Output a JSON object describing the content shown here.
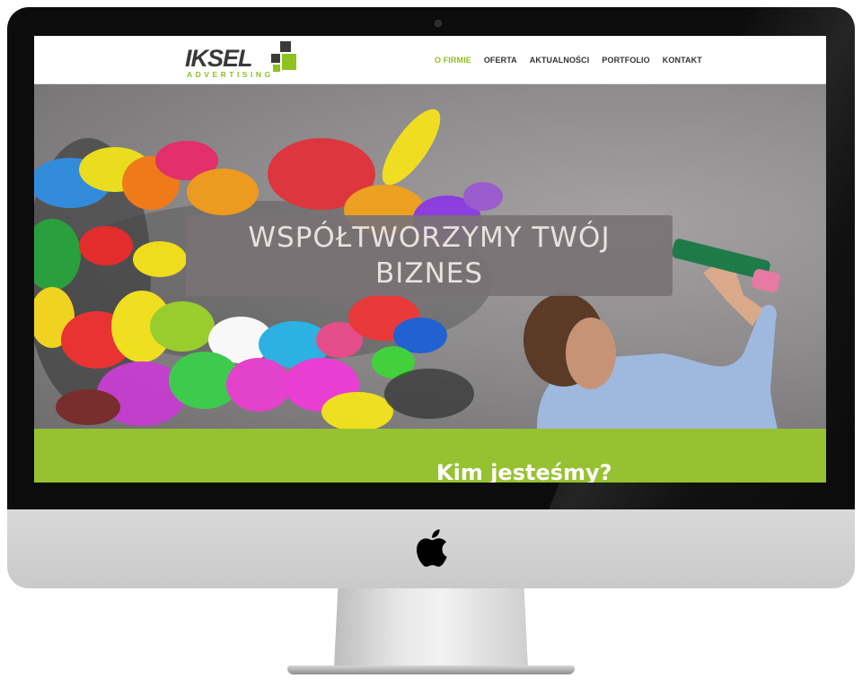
{
  "site": {
    "logo": {
      "word": "IKSEL",
      "sub": "ADVERTISING",
      "brand_color": "#8dc21f",
      "dark_color": "#3a3a3a"
    },
    "nav": [
      {
        "label": "O FIRMIE",
        "active": true
      },
      {
        "label": "OFERTA",
        "active": false
      },
      {
        "label": "AKTUALNOŚCI",
        "active": false
      },
      {
        "label": "PORTFOLIO",
        "active": false
      },
      {
        "label": "KONTAKT",
        "active": false
      }
    ],
    "hero": {
      "title": "WSPÓŁTWORZYMY TWÓJ BIZNES",
      "image": "paint-splash-man-drawing-on-wall"
    },
    "about": {
      "title": "Kim jesteśmy?",
      "background": "#96c231"
    }
  },
  "device": {
    "type": "imac",
    "logo_icon": "apple-icon",
    "camera_icon": "camera-icon"
  }
}
